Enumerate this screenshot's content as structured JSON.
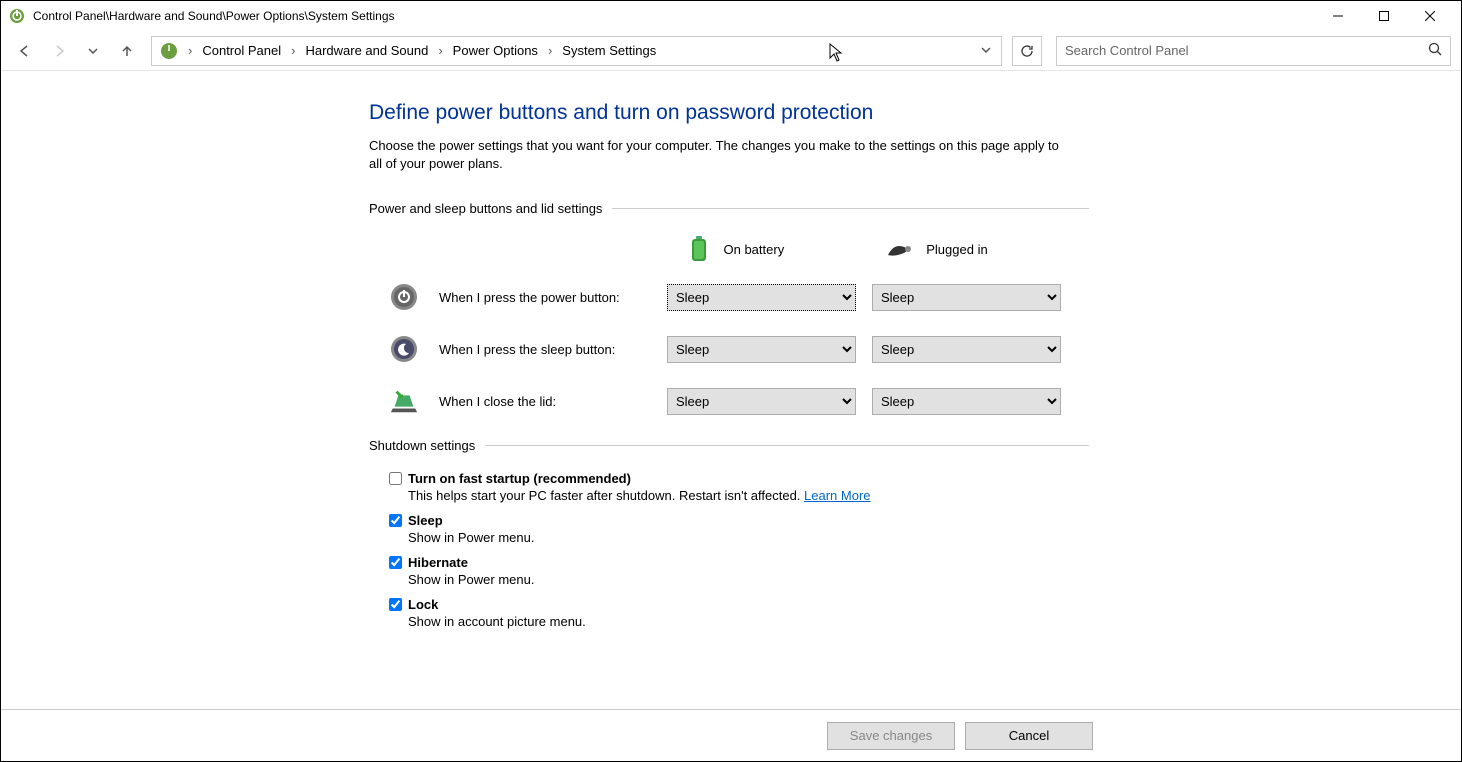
{
  "window": {
    "title": "Control Panel\\Hardware and Sound\\Power Options\\System Settings"
  },
  "breadcrumb": {
    "items": [
      "Control Panel",
      "Hardware and Sound",
      "Power Options",
      "System Settings"
    ]
  },
  "search": {
    "placeholder": "Search Control Panel"
  },
  "page": {
    "title": "Define power buttons and turn on password protection",
    "description": "Choose the power settings that you want for your computer. The changes you make to the settings on this page apply to all of your power plans."
  },
  "section1": {
    "title": "Power and sleep buttons and lid settings",
    "cols": {
      "battery": "On battery",
      "plugged": "Plugged in"
    },
    "rows": [
      {
        "label": "When I press the power button:",
        "battery": "Sleep",
        "plugged": "Sleep"
      },
      {
        "label": "When I press the sleep button:",
        "battery": "Sleep",
        "plugged": "Sleep"
      },
      {
        "label": "When I close the lid:",
        "battery": "Sleep",
        "plugged": "Sleep"
      }
    ]
  },
  "section2": {
    "title": "Shutdown settings",
    "items": [
      {
        "label": "Turn on fast startup (recommended)",
        "desc": "This helps start your PC faster after shutdown. Restart isn't affected. ",
        "learn": "Learn More"
      },
      {
        "label": "Sleep",
        "desc": "Show in Power menu."
      },
      {
        "label": "Hibernate",
        "desc": "Show in Power menu."
      },
      {
        "label": "Lock",
        "desc": "Show in account picture menu."
      }
    ]
  },
  "footer": {
    "save": "Save changes",
    "cancel": "Cancel"
  }
}
